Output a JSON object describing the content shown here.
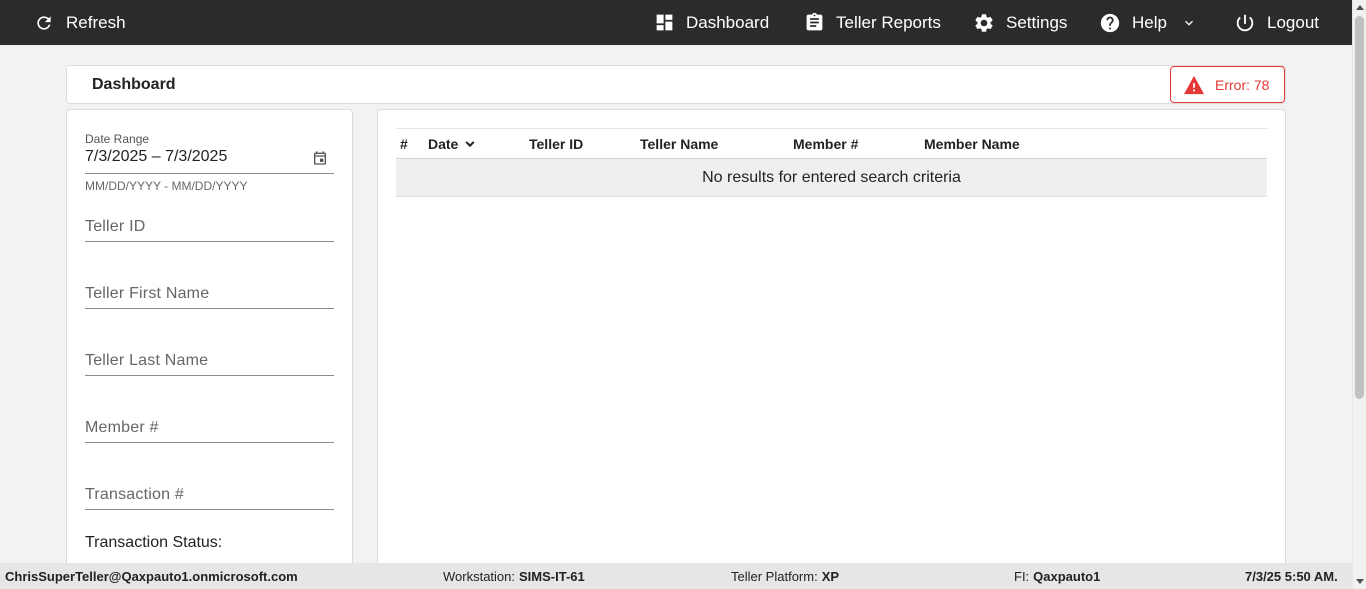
{
  "topbar": {
    "refresh_label": "Refresh",
    "dashboard_label": "Dashboard",
    "reports_label": "Teller Reports",
    "settings_label": "Settings",
    "help_label": "Help",
    "logout_label": "Logout"
  },
  "header": {
    "title": "Dashboard",
    "error_badge": "Error: 78",
    "error_color": "#e53935"
  },
  "filters": {
    "date_range_label": "Date Range",
    "date_range_value": "7/3/2025 – 7/3/2025",
    "date_hint": "MM/DD/YYYY - MM/DD/YYYY",
    "teller_id_placeholder": "Teller ID",
    "teller_first_name_placeholder": "Teller First Name",
    "teller_last_name_placeholder": "Teller Last Name",
    "member_number_placeholder": "Member #",
    "transaction_number_placeholder": "Transaction #",
    "transaction_status_label": "Transaction Status:"
  },
  "table": {
    "columns": [
      "#",
      "Date",
      "Teller ID",
      "Teller Name",
      "Member #",
      "Member Name"
    ],
    "sorted_column": "Date",
    "empty_message": "No results for entered search criteria"
  },
  "statusbar": {
    "user": "ChrisSuperTeller@Qaxpauto1.onmicrosoft.com",
    "workstation_label": "Workstation:",
    "workstation_value": "SIMS-IT-61",
    "platform_label": "Teller Platform:",
    "platform_value": "XP",
    "fi_label": "FI:",
    "fi_value": "Qaxpauto1",
    "datetime": "7/3/25 5:50 AM."
  },
  "icons": {
    "refresh": "refresh-icon",
    "dashboard": "dashboard-icon",
    "reports": "clipboard-icon",
    "settings": "gear-icon",
    "help": "help-circle-icon",
    "logout": "power-icon",
    "error": "warning-icon",
    "calendar": "calendar-icon"
  },
  "colors": {
    "topbar_bg": "#2b2b2b",
    "page_bg": "#f2f2f2"
  }
}
